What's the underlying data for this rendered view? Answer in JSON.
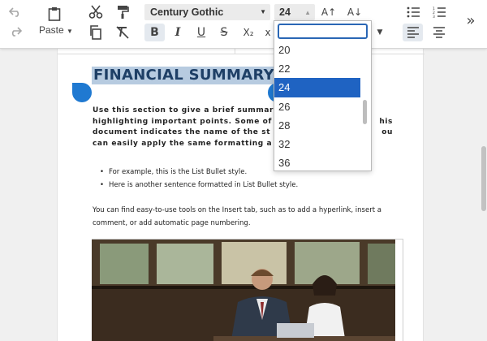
{
  "toolbar": {
    "paste_label": "Paste",
    "font_name": "Century Gothic",
    "font_size": "24",
    "icons": {
      "undo": "undo-icon",
      "redo": "redo-icon",
      "clipboard": "clipboard-icon",
      "cut": "scissors-icon",
      "copy": "copy-icon",
      "format_painter": "format-painter-icon",
      "clear_format": "clear-formatting-icon",
      "bold": "B",
      "italic": "I",
      "underline": "U",
      "strikethrough": "S",
      "subscript": "X₂",
      "grow_font": "A↑",
      "shrink_font": "A↓",
      "bullets": "bullet-list-icon",
      "numbering": "numbered-list-icon",
      "align_left": "align-left-icon",
      "align_center": "align-center-icon",
      "more": "»"
    }
  },
  "font_size_dropdown": {
    "search_value": "",
    "options": [
      "20",
      "22",
      "24",
      "26",
      "28",
      "32",
      "36"
    ],
    "selected": "24"
  },
  "document": {
    "title": "FINANCIAL SUMMARY",
    "intro_lines": [
      "Use this section to give a brief summar",
      "highlighting important points. Some of",
      "document indicates the name of the st",
      "can easily apply the same formatting a"
    ],
    "intro_tail_lines": [
      "",
      "his",
      "ou",
      ""
    ],
    "bullets": [
      "For example, this is the List Bullet style.",
      "Here is another sentence formatted in List Bullet style."
    ],
    "paragraph": "You can find easy-to-use tools on the Insert tab, such as to add a hyperlink, insert a comment, or add automatic page numbering.",
    "photo_alt": "photo-two-people-working-at-cafe-table"
  },
  "colors": {
    "selection_bg": "#b7cbe0",
    "title_color": "#1e3f66",
    "accent": "#1f63c2",
    "handle": "#1f79d1"
  }
}
